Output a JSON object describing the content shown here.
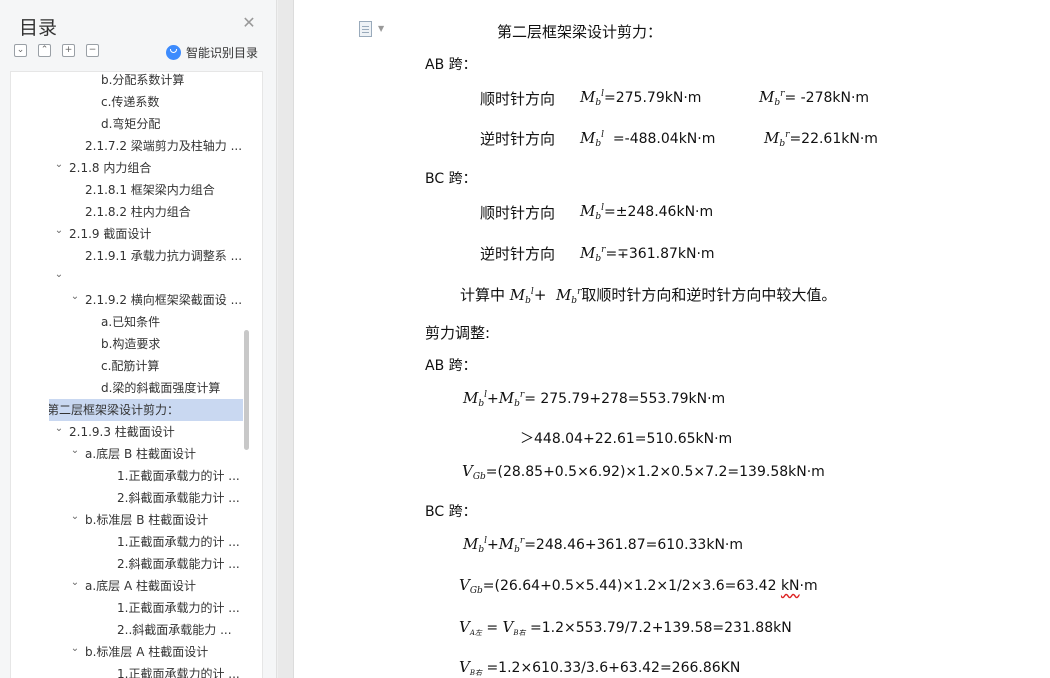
{
  "toc": {
    "title": "目录",
    "smart_label": "智能识别目录",
    "items": [
      {
        "text": "b.分配系数计算",
        "level": 3,
        "chevron": ""
      },
      {
        "text": "c.传递系数",
        "level": 3,
        "chevron": ""
      },
      {
        "text": "d.弯矩分配",
        "level": 3,
        "chevron": ""
      },
      {
        "text": "2.1.7.2  梁端剪力及柱轴力 ...",
        "level": 2,
        "chevron": ""
      },
      {
        "text": "2.1.8  内力组合",
        "level": 1,
        "chevron": "v"
      },
      {
        "text": "2.1.8.1  框架梁内力组合",
        "level": 2,
        "chevron": ""
      },
      {
        "text": "2.1.8.2  柱内力组合",
        "level": 2,
        "chevron": ""
      },
      {
        "text": "2.1.9  截面设计",
        "level": 1,
        "chevron": "v"
      },
      {
        "text": "2.1.9.1  承载力抗力调整系 ...",
        "level": 2,
        "chevron": ""
      },
      {
        "text": "",
        "level": 1,
        "chevron": "v"
      },
      {
        "text": "2.1.9.2 横向框架梁截面设 ...",
        "level": 2,
        "chevron": "v"
      },
      {
        "text": "a.已知条件",
        "level": 3,
        "chevron": ""
      },
      {
        "text": "b.构造要求",
        "level": 3,
        "chevron": ""
      },
      {
        "text": "c.配筋计算",
        "level": 3,
        "chevron": ""
      },
      {
        "text": "d.梁的斜截面强度计算",
        "level": 3,
        "chevron": ""
      },
      {
        "text": "第二层框架梁设计剪力：",
        "level": 0,
        "chevron": "v",
        "selected": true
      },
      {
        "text": "2.1.9.3  柱截面设计",
        "level": 1,
        "chevron": "v"
      },
      {
        "text": "a.底层 B 柱截面设计",
        "level": 2,
        "chevron": "v"
      },
      {
        "text": "1.正截面承载力的计 ...",
        "level": 4,
        "chevron": ""
      },
      {
        "text": "2.斜截面承载能力计 ...",
        "level": 4,
        "chevron": ""
      },
      {
        "text": "b.标准层 B 柱截面设计",
        "level": 2,
        "chevron": "v"
      },
      {
        "text": "1.正截面承载力的计 ...",
        "level": 4,
        "chevron": ""
      },
      {
        "text": "2.斜截面承载能力计 ...",
        "level": 4,
        "chevron": ""
      },
      {
        "text": "a.底层 A 柱截面设计",
        "level": 2,
        "chevron": "v"
      },
      {
        "text": "1.正截面承载力的计 ...",
        "level": 4,
        "chevron": ""
      },
      {
        "text": "2..斜截面承载能力 ...",
        "level": 4,
        "chevron": ""
      },
      {
        "text": "b.标准层 A 柱截面设计",
        "level": 2,
        "chevron": "v"
      },
      {
        "text": "1.正截面承载力的计 ...",
        "level": 4,
        "chevron": ""
      }
    ]
  },
  "doc": {
    "heading": "第二层框架梁设计剪力：",
    "ab_span": "AB 跨：",
    "bc_span": "BC 跨：",
    "clockwise": "顺时针方向",
    "counter": "逆时针方向",
    "M": "M",
    "b": "b",
    "l": "l",
    "r": "r",
    "V": "V",
    "Gb": "Gb",
    "ab1_l": "=275.79kN·m",
    "ab1_r": "= -278kN·m",
    "ab2_l": "=-488.04kN·m",
    "ab2_r": "=22.61kN·m",
    "bc1": "=±248.46kN·m",
    "bc2": "=∓361.87kN·m",
    "calc_prefix": "计算中",
    "plus": "+",
    "calc_suffix": "取顺时针方向和逆时针方向中较大值。",
    "adjust": "剪力调整:",
    "ab_sum": "= 275.79+278=553.79kN·m",
    "ab_cmp": "＞448.04+22.61=510.65kN·m",
    "ab_vgb": "=(28.85+0.5×6.92)×1.2×0.5×7.2=139.58kN·m",
    "bc_sum": "=248.46+361.87=610.33kN·m",
    "bc_vgb_a": "=(26.64+0.5×5.44)×1.2×1/2×3.6=63.42 ",
    "bc_vgb_unit": "kN",
    "bc_vgb_b": "·m",
    "va_sub": "A左",
    "vb_sub": "B右",
    "vab_eq": " = ",
    "vab_val": " =1.2×553.79/7.2+139.58=231.88kN",
    "vbc_val": " =1.2×610.33/3.6+63.42=266.86KN"
  }
}
